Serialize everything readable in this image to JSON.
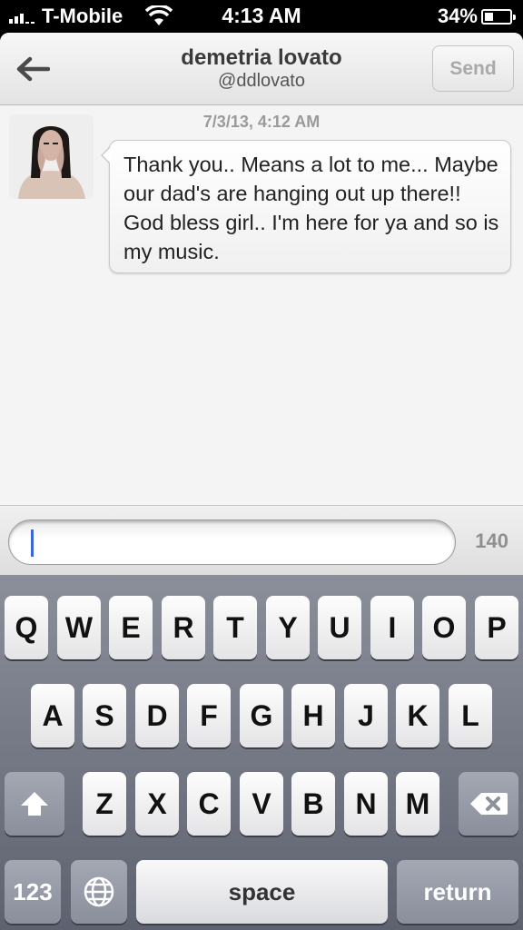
{
  "status_bar": {
    "carrier": "T-Mobile",
    "time": "4:13 AM",
    "battery_percent": "34%",
    "battery_level": 0.34,
    "icons": [
      "signal-icon",
      "wifi-icon",
      "battery-icon"
    ]
  },
  "nav": {
    "title": "demetria lovato",
    "subtitle": "@ddlovato",
    "send_label": "Send",
    "back_icon": "back-arrow-icon"
  },
  "thread": {
    "timestamp": "7/3/13, 4:12 AM",
    "messages": [
      {
        "text": "Thank you.. Means a lot to me... Maybe our dad's are hanging out up there!! God bless girl.. I'm here for ya and so is my music."
      }
    ]
  },
  "composer": {
    "value": "",
    "char_count": "140"
  },
  "keyboard": {
    "row1": [
      "Q",
      "W",
      "E",
      "R",
      "T",
      "Y",
      "U",
      "I",
      "O",
      "P"
    ],
    "row2": [
      "A",
      "S",
      "D",
      "F",
      "G",
      "H",
      "J",
      "K",
      "L"
    ],
    "row3": [
      "Z",
      "X",
      "C",
      "V",
      "B",
      "N",
      "M"
    ],
    "numbers_label": "123",
    "space_label": "space",
    "return_label": "return"
  },
  "colors": {
    "caret": "#3c66d6",
    "keyboard_bg": "#6b707c"
  }
}
